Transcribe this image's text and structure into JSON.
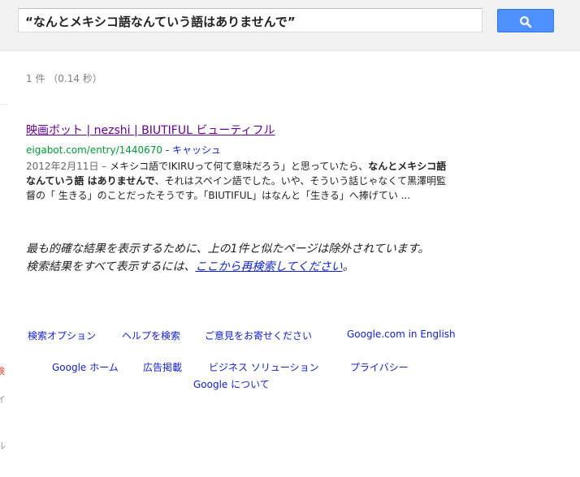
{
  "search": {
    "query": "“なんとメキシコ語なんていう語はありませんで”"
  },
  "result_stats": "1 件 （0.14 秒）",
  "result": {
    "title": "映画ボット | nezshi | BIUTIFUL ビューティフル",
    "url": "eigabot.com/entry/1440670",
    "separator": " - ",
    "cache_label": "キャッシュ",
    "date": "2012年2月11日 –",
    "snippet_part1": " メキシコ語でIKIRUって何て意味だろう」と思っていたら、",
    "snippet_bold": "なんとメキシコ語なんていう語 はありませんで",
    "snippet_part2": "、それはスペイン語でした。いや、そういう話じゃなくて黒澤明監督の「 生きる」のことだったそうです。「BIUTIFUL」はなんと「生きる」へ捧げてい ..."
  },
  "omitted": {
    "line1": "最も的確な結果を表示するために、上の1件と似たページは除外されています。",
    "line2_prefix": "検索結果をすべて表示するには、",
    "line2_link": "ここから再検索してください",
    "line2_suffix": "。"
  },
  "footer": {
    "row1": [
      "検索オプション",
      "ヘルプを検索",
      "ご意見をお寄せください",
      "Google.com in English"
    ],
    "row2": [
      "Google ホーム",
      "広告掲載",
      "ビジネス ソリューション",
      "プライバシー"
    ],
    "row3": [
      "Google について"
    ]
  },
  "left_edge": [
    "検",
    "イ",
    "ル"
  ],
  "colors": {
    "button": "#4d90fe",
    "link": "#1122cc",
    "visited_link": "#660099",
    "url_green": "#009933"
  },
  "icons": {
    "search_button": "magnifier-icon"
  }
}
